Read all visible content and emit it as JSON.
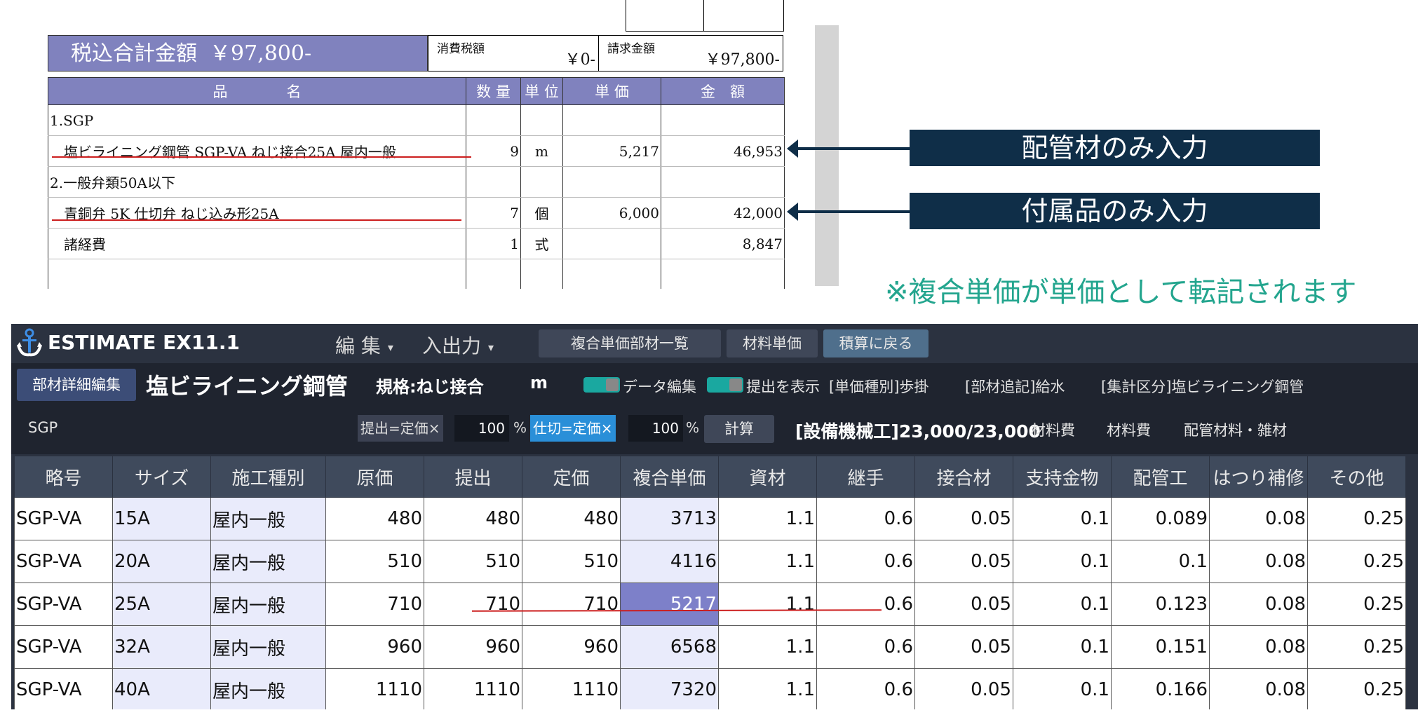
{
  "invoice": {
    "total_label": "税込合計金額",
    "total_value": "￥97,800-",
    "tax_label": "消費税額",
    "tax_value": "￥0-",
    "bill_label": "請求金額",
    "bill_value": "￥97,800-",
    "headers": [
      "品　　　　名",
      "数 量",
      "単 位",
      "単 価",
      "金　額"
    ],
    "rows": [
      {
        "name": "1.SGP",
        "qty": "",
        "unit": "",
        "price": "",
        "amount": ""
      },
      {
        "name": "塩ビライニング鋼管 SGP-VA ねじ接合25A 屋内一般",
        "qty": "9",
        "unit": "m",
        "price": "5,217",
        "amount": "46,953"
      },
      {
        "name": "2.一般弁類50A以下",
        "qty": "",
        "unit": "",
        "price": "",
        "amount": ""
      },
      {
        "name": "青銅弁 5K 仕切弁 ねじ込み形25A",
        "qty": "7",
        "unit": "個",
        "price": "6,000",
        "amount": "42,000"
      },
      {
        "name": "諸経費",
        "qty": "1",
        "unit": "式",
        "price": "",
        "amount": "8,847"
      },
      {
        "name": "",
        "qty": "",
        "unit": "",
        "price": "",
        "amount": ""
      }
    ]
  },
  "callouts": {
    "piping": "配管材のみ入力",
    "accessories": "付属品のみ入力",
    "note": "※複合単価が単価として転記されます"
  },
  "app": {
    "title": "ESTIMATE EX11.1",
    "menus": [
      "編 集",
      "入出力"
    ],
    "toolbar_buttons": [
      "複合単価部材一覧",
      "材料単価",
      "積算に戻る"
    ],
    "info": {
      "edit_button": "部材詳細編集",
      "product_name": "塩ビライニング鋼管",
      "spec": "規格:ねじ接合",
      "unit": "m",
      "toggle1_label": "データ編集",
      "toggle2_label": "提出を表示",
      "price_type": "[単価種別]歩掛",
      "additional": "[部材追記]給水",
      "category": "[集計区分]塩ビライニング鋼管",
      "category_code": "SGP",
      "filter1": "提出=定価×",
      "filter1_value": "100",
      "filter2": "仕切=定価×",
      "filter2_value": "100",
      "percent": "%",
      "calc_button": "計算",
      "labor": "[設備機械工]23,000/23,000",
      "material1": "材料費",
      "material2": "材料費",
      "material3": "配管材料・雑材"
    },
    "grid": {
      "headers": [
        "略号",
        "サイズ",
        "施工種別",
        "原価",
        "提出",
        "定価",
        "複合単価",
        "資材",
        "継手",
        "接合材",
        "支持金物",
        "配管工",
        "はつり補修",
        "その他"
      ],
      "rows": [
        [
          "SGP-VA",
          "15A",
          "屋内一般",
          "480",
          "480",
          "480",
          "3713",
          "1.1",
          "0.6",
          "0.05",
          "0.1",
          "0.089",
          "0.08",
          "0.25"
        ],
        [
          "SGP-VA",
          "20A",
          "屋内一般",
          "510",
          "510",
          "510",
          "4116",
          "1.1",
          "0.6",
          "0.05",
          "0.1",
          "0.1",
          "0.08",
          "0.25"
        ],
        [
          "SGP-VA",
          "25A",
          "屋内一般",
          "710",
          "710",
          "710",
          "5217",
          "1.1",
          "0.6",
          "0.05",
          "0.1",
          "0.123",
          "0.08",
          "0.25"
        ],
        [
          "SGP-VA",
          "32A",
          "屋内一般",
          "960",
          "960",
          "960",
          "6568",
          "1.1",
          "0.6",
          "0.05",
          "0.1",
          "0.151",
          "0.08",
          "0.25"
        ],
        [
          "SGP-VA",
          "40A",
          "屋内一般",
          "1110",
          "1110",
          "1110",
          "7320",
          "1.1",
          "0.6",
          "0.05",
          "0.1",
          "0.166",
          "0.08",
          "0.25"
        ]
      ],
      "selected_row": 2
    }
  }
}
